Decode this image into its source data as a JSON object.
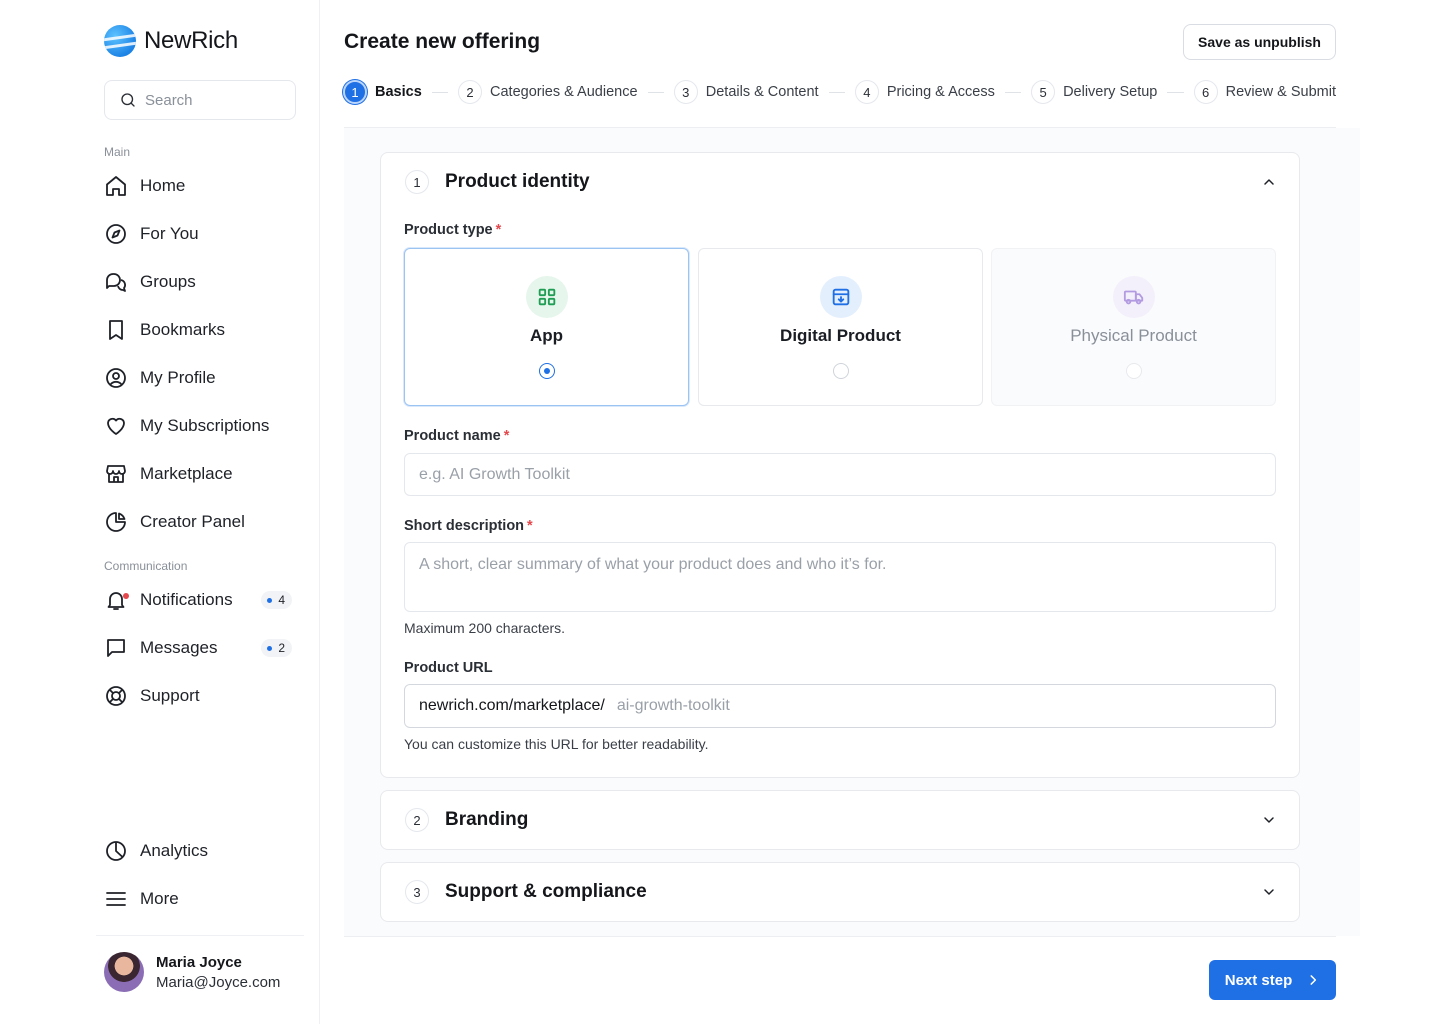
{
  "brand": {
    "name": "NewRich",
    "accent": "#1f6fe5"
  },
  "search": {
    "placeholder": "Search"
  },
  "sidebar": {
    "main_label": "Main",
    "main_items": [
      {
        "label": "Home",
        "icon": "home-icon"
      },
      {
        "label": "For You",
        "icon": "compass-icon"
      },
      {
        "label": "Groups",
        "icon": "chat-bubbles-icon"
      },
      {
        "label": "Bookmarks",
        "icon": "bookmark-icon"
      },
      {
        "label": "My Profile",
        "icon": "user-circle-icon"
      },
      {
        "label": "My Subscriptions",
        "icon": "heart-icon"
      },
      {
        "label": "Marketplace",
        "icon": "store-icon"
      },
      {
        "label": "Creator Panel",
        "icon": "pie-chart-icon"
      }
    ],
    "communication_label": "Communication",
    "communication_items": [
      {
        "label": "Notifications",
        "icon": "bell-icon",
        "badge": "4"
      },
      {
        "label": "Messages",
        "icon": "message-icon",
        "badge": "2"
      },
      {
        "label": "Support",
        "icon": "lifebuoy-icon"
      }
    ],
    "bottom_items": [
      {
        "label": "Analytics",
        "icon": "analytics-icon"
      },
      {
        "label": "More",
        "icon": "menu-icon"
      }
    ],
    "user": {
      "name": "Maria Joyce",
      "email": "Maria@Joyce.com"
    }
  },
  "header": {
    "title": "Create new offering",
    "save_unpublish": "Save as unpublish"
  },
  "steps": [
    {
      "num": "1",
      "label": "Basics",
      "active": true
    },
    {
      "num": "2",
      "label": "Categories & Audience"
    },
    {
      "num": "3",
      "label": "Details & Content"
    },
    {
      "num": "4",
      "label": "Pricing & Access"
    },
    {
      "num": "5",
      "label": "Delivery Setup"
    },
    {
      "num": "6",
      "label": "Review & Submit"
    }
  ],
  "sections": {
    "identity": {
      "num": "1",
      "title": "Product identity"
    },
    "branding": {
      "num": "2",
      "title": "Branding"
    },
    "support": {
      "num": "3",
      "title": "Support & compliance"
    }
  },
  "form": {
    "product_type_label": "Product type",
    "required_mark": "*",
    "types": [
      {
        "name": "App",
        "icon": "grid-icon",
        "selected": true
      },
      {
        "name": "Digital Product",
        "icon": "download-box-icon",
        "selected": false
      },
      {
        "name": "Physical Product",
        "icon": "truck-icon",
        "selected": false,
        "disabled": true
      }
    ],
    "product_name_label": "Product name",
    "product_name_placeholder": "e.g. AI Growth Toolkit",
    "short_desc_label": "Short description",
    "short_desc_placeholder": "A short, clear summary of what your product does and who it’s for.",
    "short_desc_helper": "Maximum 200 characters.",
    "url_label": "Product URL",
    "url_prefix": "newrich.com/marketplace/",
    "url_placeholder": "ai-growth-toolkit",
    "url_helper": "You can customize this URL for better readability."
  },
  "footer": {
    "next_label": "Next step"
  }
}
